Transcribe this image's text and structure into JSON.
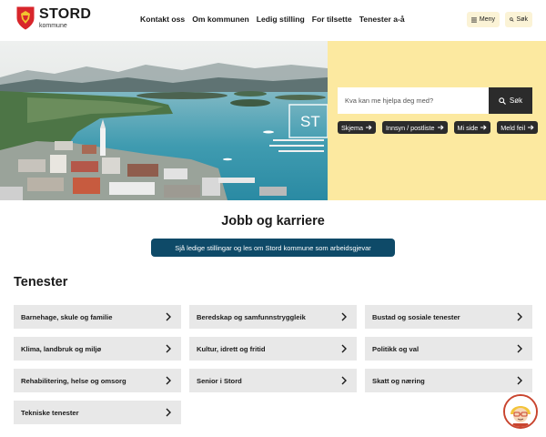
{
  "brand": {
    "name": "STORD",
    "sub": "kommune"
  },
  "nav": [
    "Kontakt oss",
    "Om kommunen",
    "Ledig stilling",
    "For tilsette",
    "Tenester a-å"
  ],
  "header_buttons": {
    "menu": "Meny",
    "search": "Søk"
  },
  "hero": {
    "search_placeholder": "Kva kan me hjelpa deg med?",
    "search_button": "Søk",
    "photo_sign": "ST",
    "chips": [
      "Skjema",
      "Innsyn / postliste",
      "Mi side",
      "Meld feil"
    ]
  },
  "jobb": {
    "title": "Jobb og karriere",
    "button": "Sjå ledige stillingar og les om Stord kommune som arbeidsgjevar"
  },
  "tenester": {
    "title": "Tenester",
    "items": [
      "Barnehage, skule og familie",
      "Beredskap og samfunnstryggleik",
      "Bustad og sosiale tenester",
      "Klima, landbruk og miljø",
      "Kultur, idrett og fritid",
      "Politikk og val",
      "Rehabilitering, helse og omsorg",
      "Senior i Stord",
      "Skatt og næring",
      "Tekniske tenester"
    ]
  },
  "colors": {
    "accent_yellow": "#fce9a0",
    "dark_blue": "#0e4a68",
    "dark": "#2b2b2b",
    "tile": "#e8e8e8"
  }
}
